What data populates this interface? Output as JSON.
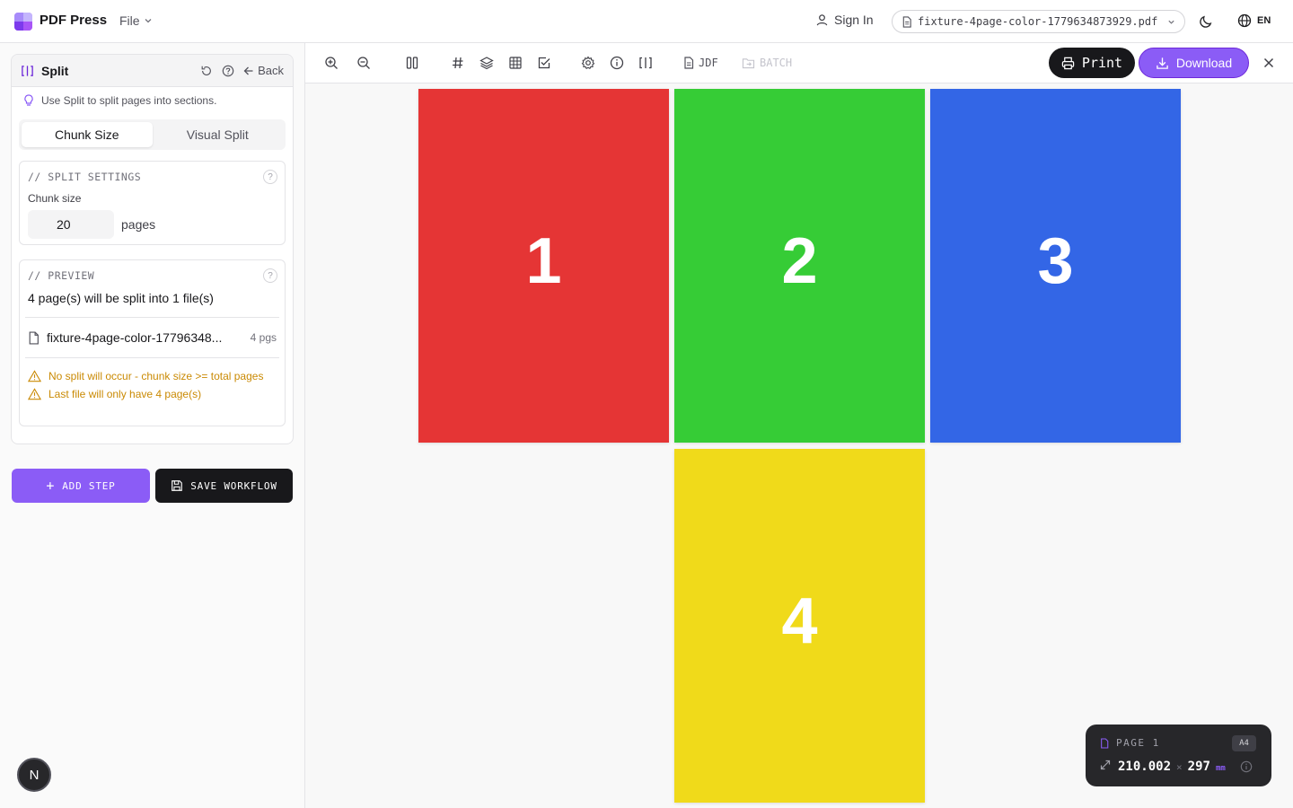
{
  "app": {
    "name": "PDF Press",
    "file_menu": "File"
  },
  "header": {
    "sign_in": "Sign In",
    "file_name": "fixture-4page-color-1779634873929.pdf",
    "language": "EN"
  },
  "tool": {
    "title": "Split",
    "back": "Back",
    "hint": "Use Split to split pages into sections.",
    "tabs": [
      "Chunk Size",
      "Visual Split"
    ],
    "active_tab": "Chunk Size",
    "split_settings_label": "// SPLIT SETTINGS",
    "chunk_size_label": "Chunk size",
    "chunk_size_value": "20",
    "chunk_unit": "pages",
    "preview_label": "// PREVIEW",
    "preview_summary": "4 page(s) will be split into 1 file(s)",
    "preview_file_name": "fixture-4page-color-17796348...",
    "preview_file_pages": "4 pgs",
    "warnings": [
      "No split will occur - chunk size >= total pages",
      "Last file will only have 4 page(s)"
    ]
  },
  "actions": {
    "add_step": "ADD STEP",
    "save_workflow": "SAVE WORKFLOW"
  },
  "toolbar": {
    "jdf": "JDF",
    "batch": "BATCH",
    "print": "Print",
    "download": "Download",
    "icons": [
      "zoom-in-icon",
      "zoom-out-icon",
      "columns-icon",
      "hash-icon",
      "layers-icon",
      "grid-icon",
      "check-square-icon",
      "settings-icon",
      "info-icon",
      "split-icon"
    ]
  },
  "pages": [
    {
      "number": "1",
      "color": "#e53535"
    },
    {
      "number": "2",
      "color": "#36cc36"
    },
    {
      "number": "3",
      "color": "#3366e6"
    },
    {
      "number": "4",
      "color": "#f0da1a"
    }
  ],
  "page_info": {
    "label": "PAGE 1",
    "paper": "A4",
    "width": "210.002",
    "height": "297",
    "unit": "mm"
  },
  "badge": "N",
  "colors": {
    "accent": "#8b5cf6",
    "dark": "#18181b",
    "warning": "#ca8a04"
  }
}
